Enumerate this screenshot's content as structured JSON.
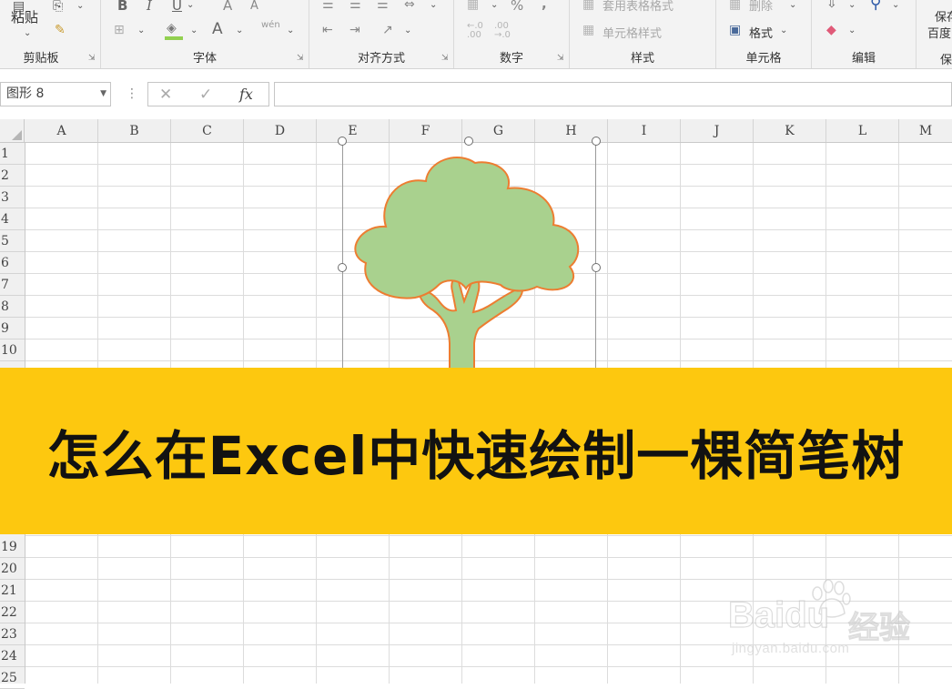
{
  "ribbon": {
    "clipboard": {
      "label": "剪贴板",
      "paste_label": "粘贴"
    },
    "font": {
      "label": "字体",
      "bold": "B",
      "italic": "I",
      "underline": "U",
      "grow": "A",
      "shrink": "A",
      "font_color": "A",
      "phonetic": "wén"
    },
    "alignment": {
      "label": "对齐方式"
    },
    "number": {
      "label": "数字",
      "percent": "%",
      "comma": ","
    },
    "styles": {
      "label": "样式",
      "table_style": "套用表格格式",
      "cell_style": "单元格样式"
    },
    "cells": {
      "label": "单元格",
      "delete": "删除",
      "format": "格式"
    },
    "editing": {
      "label": "编辑"
    },
    "save": {
      "line1": "保存",
      "line2": "百度"
    },
    "cut_off": {
      "label": "保"
    }
  },
  "formula_bar": {
    "name_box": "图形 8",
    "fx": "fx",
    "value": ""
  },
  "columns": [
    "A",
    "B",
    "C",
    "D",
    "E",
    "F",
    "G",
    "H",
    "I",
    "J",
    "K",
    "L",
    "M"
  ],
  "rows_top": [
    "1",
    "2",
    "3",
    "4",
    "5",
    "6",
    "7",
    "8",
    "9",
    "10"
  ],
  "rows_bottom": [
    "19",
    "20",
    "21",
    "22",
    "23",
    "24",
    "25"
  ],
  "banner": {
    "title": "怎么在Excel中快速绘制一棵简笔树",
    "color": "#fdc80f"
  },
  "tree": {
    "fill": "#a9d18e",
    "outline": "#ed7d31"
  },
  "watermark": {
    "brand": "Bai",
    "brand2": "du",
    "cn": "经验",
    "url": "jingyan.baidu.com"
  }
}
